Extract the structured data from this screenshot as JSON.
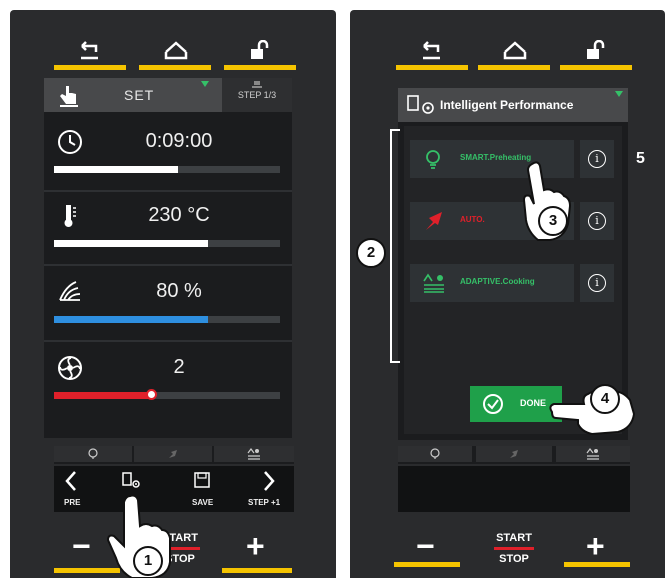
{
  "left_panel": {
    "header": {
      "label": "SET",
      "step": "STEP 1/3"
    },
    "rows": [
      {
        "icon": "clock-icon",
        "value": "0:09:00",
        "fill_fraction": 0.55,
        "color": "#ffffff"
      },
      {
        "icon": "thermometer-icon",
        "value": "230 °C",
        "fill_fraction": 0.68,
        "color": "#ffffff"
      },
      {
        "icon": "humidity-icon",
        "value": "80 %",
        "fill_fraction": 0.68,
        "color": "#2e8fe0"
      },
      {
        "icon": "fan-icon",
        "value": "2",
        "fill_fraction": 0.43,
        "color": "#e0202a"
      }
    ],
    "nav": {
      "pre": "PRE",
      "ip": "IP",
      "save": "SAVE",
      "step_next": "STEP +1"
    },
    "bottom": {
      "minus": "−",
      "plus": "+",
      "start": "START",
      "stop": "STOP"
    }
  },
  "right_panel": {
    "header": {
      "title": "Intelligent Performance"
    },
    "items": [
      {
        "label": "SMART.Preheating",
        "color": "#35c068"
      },
      {
        "label": "AUTO.",
        "color": "#e0202a"
      },
      {
        "label": "ADAPTIVE.Cooking",
        "color": "#35c068"
      }
    ],
    "info_glyph": "i",
    "done_label": "DONE",
    "bottom": {
      "minus": "−",
      "plus": "+",
      "start": "START",
      "stop": "STOP"
    }
  },
  "callouts": [
    "1",
    "2",
    "3",
    "4",
    "5"
  ],
  "colors": {
    "accent": "#f5c400",
    "green": "#35c068",
    "red": "#e0202a",
    "blue": "#2e8fe0"
  }
}
